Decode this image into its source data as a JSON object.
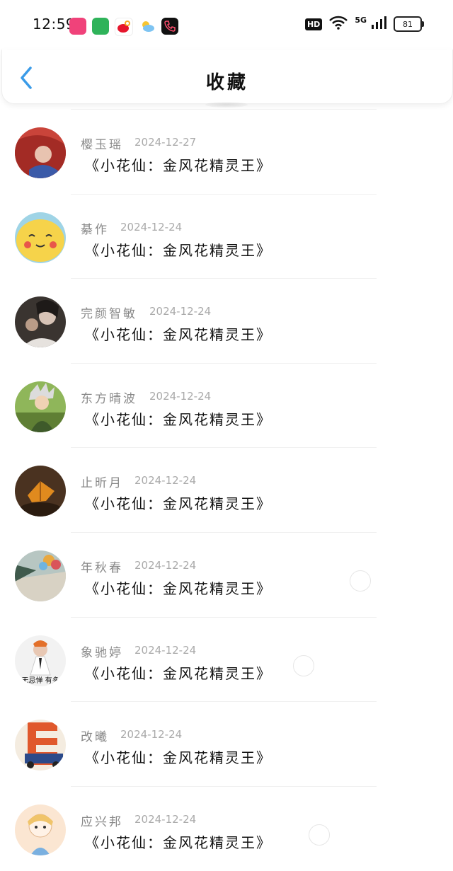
{
  "status_bar": {
    "time": "12:59",
    "hd_label": "HD",
    "network_label": "5G",
    "battery": "81"
  },
  "header": {
    "title": "收藏"
  },
  "favorites": [
    {
      "name": "樱玉瑶",
      "date": "2024-12-27",
      "title": "《小花仙：金风花精灵王》"
    },
    {
      "name": "綦作",
      "date": "2024-12-24",
      "title": "《小花仙：金风花精灵王》"
    },
    {
      "name": "完颜智敏",
      "date": "2024-12-24",
      "title": "《小花仙：金风花精灵王》"
    },
    {
      "name": "东方晴波",
      "date": "2024-12-24",
      "title": "《小花仙：金风花精灵王》"
    },
    {
      "name": "止昕月",
      "date": "2024-12-24",
      "title": "《小花仙：金风花精灵王》"
    },
    {
      "name": "年秋春",
      "date": "2024-12-24",
      "title": "《小花仙：金风花精灵王》"
    },
    {
      "name": "象驰婷",
      "date": "2024-12-24",
      "title": "《小花仙：金风花精灵王》"
    },
    {
      "name": "改曦",
      "date": "2024-12-24",
      "title": "《小花仙：金风花精灵王》"
    },
    {
      "name": "应兴邦",
      "date": "2024-12-24",
      "title": "《小花仙：金风花精灵王》"
    }
  ],
  "avatar7_caption": "无忌惮 有多",
  "colors": {
    "accent": "#3a9be8",
    "name_text": "#888888",
    "date_text": "#aaaaaa"
  }
}
